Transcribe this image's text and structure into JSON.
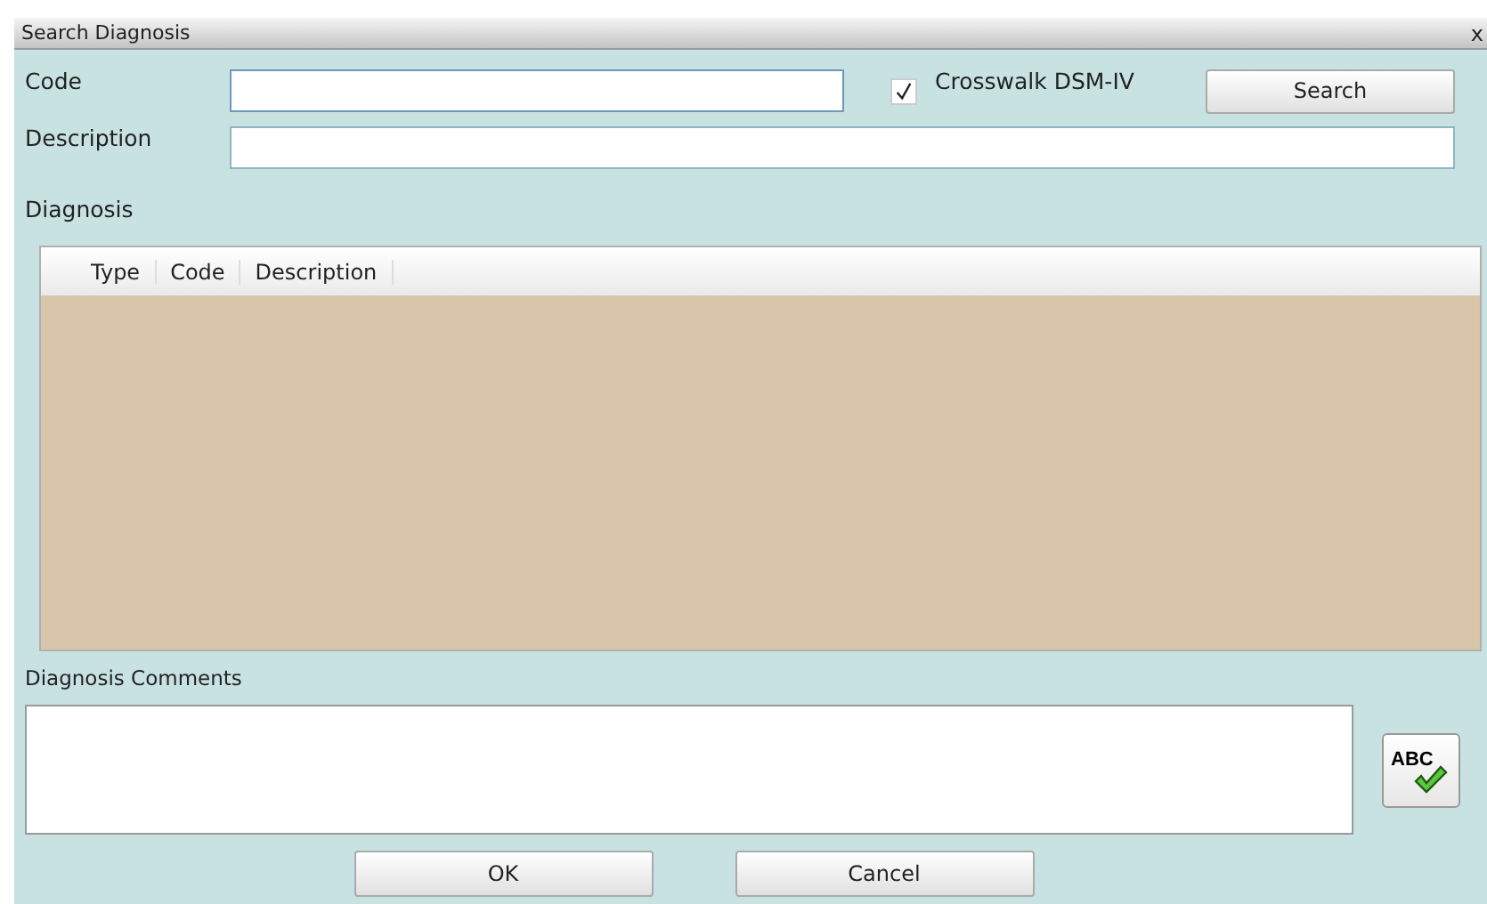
{
  "window": {
    "title": "Search Diagnosis",
    "close": "x"
  },
  "code": {
    "label": "Code"
  },
  "crosswalk": {
    "label": "Crosswalk DSM-IV",
    "checked": true
  },
  "search_button": "Search",
  "description": {
    "label": "Description"
  },
  "diagnosis": {
    "label": "Diagnosis",
    "columns": [
      "Type",
      "Code",
      "Description"
    ]
  },
  "comments": {
    "label": "Diagnosis Comments",
    "spellcheck": "ABC"
  },
  "buttons": [
    "OK",
    "Cancel"
  ]
}
